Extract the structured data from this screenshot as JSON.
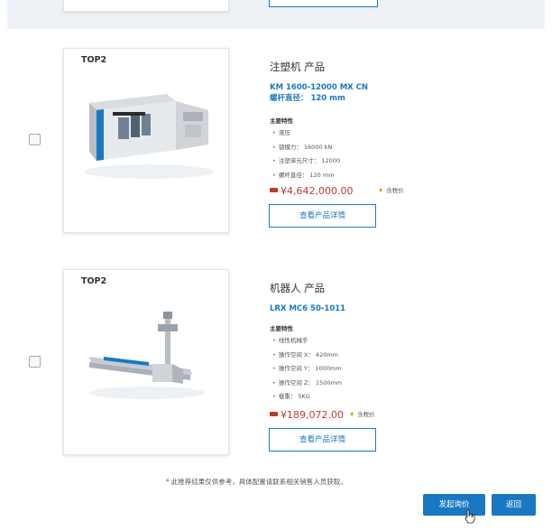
{
  "products": [
    {
      "badge": "TOP2",
      "category": "注塑机 产品",
      "model_line1": "KM 1600-12000 MX CN",
      "model_line2": "螺杆直径： 120 mm",
      "features_title": "主要特性",
      "features": [
        "液压",
        "锁模力： 16000 kN",
        "注塑单元尺寸： 12000",
        "螺杆直径： 120 mm"
      ],
      "price": "¥4,642,000.00",
      "tax_note": "含税价",
      "detail_label": "查看产品详情",
      "image_icon": "injection-molding-machine-image"
    },
    {
      "badge": "TOP2",
      "category": "机器人 产品",
      "model_line1": "LRX MC6 50-1011",
      "features_title": "主要特性",
      "features": [
        "线性机械手",
        "操作空间 X： 420mm",
        "操作空间 Y： 1000mm",
        "操作空间 Z： 1500mm",
        "载重： 5KG"
      ],
      "price": "¥189,072.00",
      "tax_note": "含税价",
      "detail_label": "查看产品详情",
      "image_icon": "linear-robot-image"
    }
  ],
  "footer": {
    "disclaimer_mark": "*",
    "disclaimer": "此推荐结果仅供参考，具体配置请联系相关销售人员获取。",
    "inquiry_label": "发起询价",
    "back_label": "返回"
  },
  "colors": {
    "accent": "#1a78c2",
    "price": "#c0392b",
    "star": "#f0a020"
  }
}
